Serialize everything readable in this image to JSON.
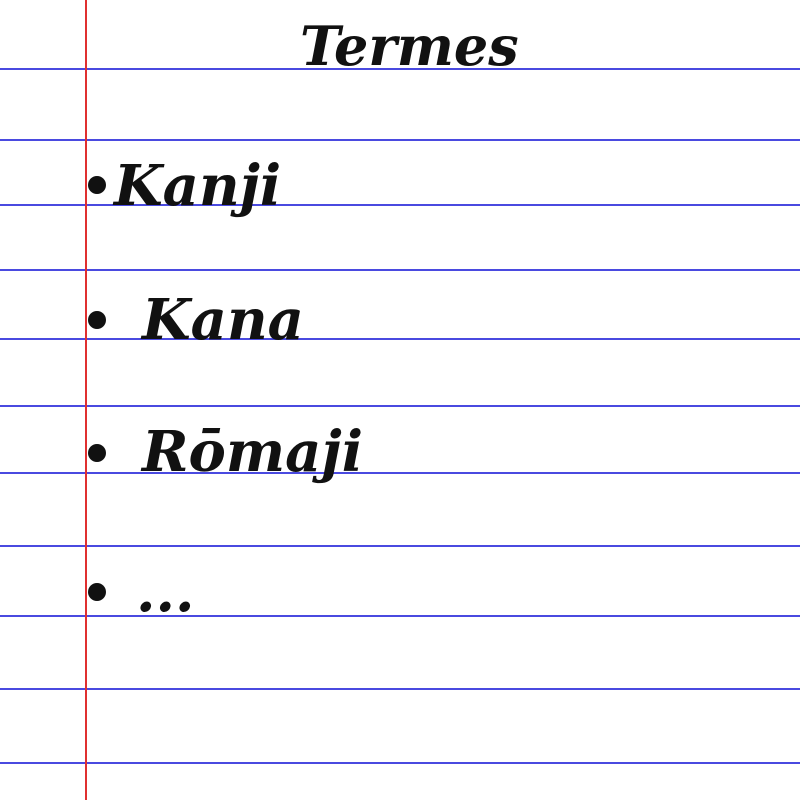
{
  "notebook": {
    "title": "Termes",
    "items": [
      {
        "label": "Kanji"
      },
      {
        "label": "Kana"
      },
      {
        "label": "Rōmaji"
      },
      {
        "label": "..."
      }
    ]
  },
  "colors": {
    "rule_line": "#4a4ae0",
    "margin_line": "#e03030",
    "ink": "#111111",
    "paper": "#ffffff"
  }
}
